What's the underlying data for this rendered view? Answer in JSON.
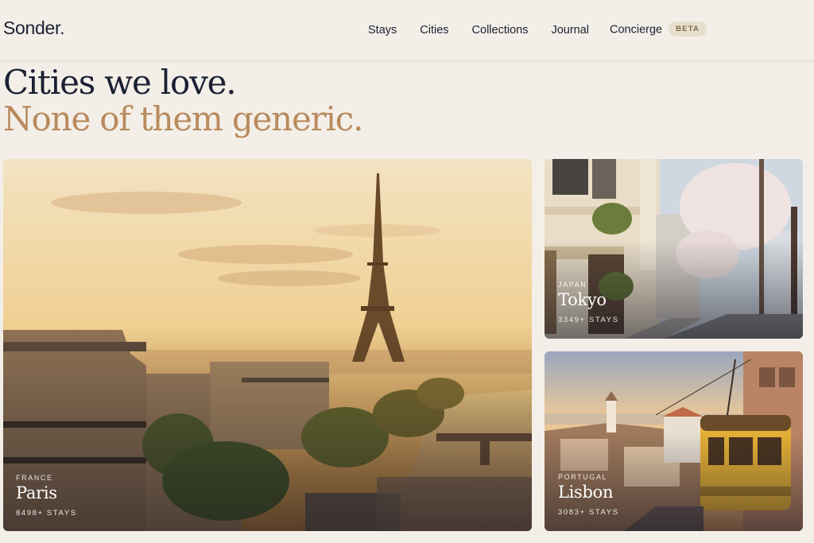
{
  "header": {
    "logo": "Sonder.",
    "nav": [
      "Stays",
      "Cities",
      "Collections",
      "Journal",
      "Concierge"
    ],
    "badge": "BETA"
  },
  "hero": {
    "line1": "Cities we love.",
    "line2": "None of them generic."
  },
  "cities": [
    {
      "country": "FRANCE",
      "name": "Paris",
      "stays": "8498+ STAYS"
    },
    {
      "country": "JAPAN",
      "name": "Tokyo",
      "stays": "3349+ STAYS"
    },
    {
      "country": "PORTUGAL",
      "name": "Lisbon",
      "stays": "3083+ STAYS"
    }
  ],
  "colors": {
    "background": "#f3efe8",
    "ink": "#1b2133",
    "accent": "#b98a5d",
    "badge_bg": "#e7dfcd"
  }
}
